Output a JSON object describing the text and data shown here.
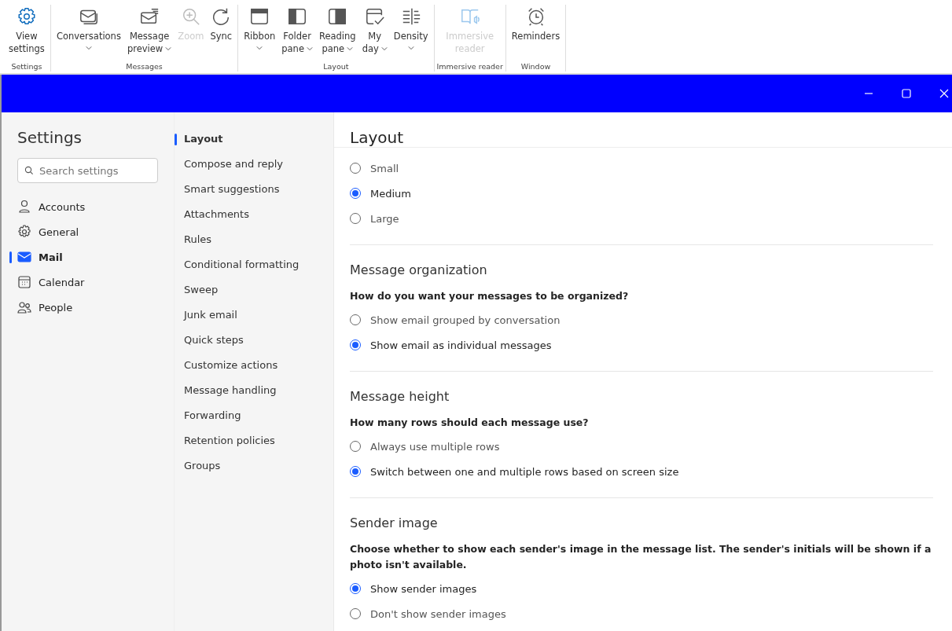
{
  "ribbon": {
    "groups": [
      {
        "label": "Settings",
        "items": [
          {
            "lines": [
              "View",
              "settings"
            ],
            "dropdown": false,
            "disabled": false
          }
        ]
      },
      {
        "label": "Messages",
        "items": [
          {
            "lines": [
              "Conversations"
            ],
            "dropdown": true,
            "disabled": false
          },
          {
            "lines": [
              "Message",
              "preview"
            ],
            "dropdown": true,
            "disabled": false
          },
          {
            "lines": [
              "Zoom"
            ],
            "dropdown": false,
            "disabled": true
          },
          {
            "lines": [
              "Sync"
            ],
            "dropdown": false,
            "disabled": false
          }
        ]
      },
      {
        "label": "Layout",
        "items": [
          {
            "lines": [
              "Ribbon"
            ],
            "dropdown": true,
            "disabled": false
          },
          {
            "lines": [
              "Folder",
              "pane"
            ],
            "dropdown": true,
            "disabled": false
          },
          {
            "lines": [
              "Reading",
              "pane"
            ],
            "dropdown": true,
            "disabled": false
          },
          {
            "lines": [
              "My",
              "day"
            ],
            "dropdown": true,
            "disabled": false
          },
          {
            "lines": [
              "Density"
            ],
            "dropdown": true,
            "disabled": false
          }
        ]
      },
      {
        "label": "Immersive reader",
        "items": [
          {
            "lines": [
              "Immersive",
              "reader"
            ],
            "dropdown": false,
            "disabled": true
          }
        ]
      },
      {
        "label": "Window",
        "items": [
          {
            "lines": [
              "Reminders"
            ],
            "dropdown": false,
            "disabled": false
          }
        ]
      }
    ]
  },
  "settings": {
    "title": "Settings",
    "search": {
      "placeholder": "Search settings"
    },
    "nav": [
      {
        "label": "Accounts",
        "selected": false
      },
      {
        "label": "General",
        "selected": false
      },
      {
        "label": "Mail",
        "selected": true
      },
      {
        "label": "Calendar",
        "selected": false
      },
      {
        "label": "People",
        "selected": false
      }
    ],
    "subnav": [
      {
        "label": "Layout",
        "selected": true
      },
      {
        "label": "Compose and reply",
        "selected": false
      },
      {
        "label": "Smart suggestions",
        "selected": false
      },
      {
        "label": "Attachments",
        "selected": false
      },
      {
        "label": "Rules",
        "selected": false
      },
      {
        "label": "Conditional formatting",
        "selected": false
      },
      {
        "label": "Sweep",
        "selected": false
      },
      {
        "label": "Junk email",
        "selected": false
      },
      {
        "label": "Quick steps",
        "selected": false
      },
      {
        "label": "Customize actions",
        "selected": false
      },
      {
        "label": "Message handling",
        "selected": false
      },
      {
        "label": "Forwarding",
        "selected": false
      },
      {
        "label": "Retention policies",
        "selected": false
      },
      {
        "label": "Groups",
        "selected": false
      }
    ]
  },
  "content": {
    "title": "Layout",
    "sections": [
      {
        "options": [
          {
            "label": "Small",
            "selected": false
          },
          {
            "label": "Medium",
            "selected": true
          },
          {
            "label": "Large",
            "selected": false
          }
        ]
      },
      {
        "title": "Message organization",
        "question": "How do you want your messages to be organized?",
        "options": [
          {
            "label": "Show email grouped by conversation",
            "selected": false
          },
          {
            "label": "Show email as individual messages",
            "selected": true
          }
        ]
      },
      {
        "title": "Message height",
        "question": "How many rows should each message use?",
        "options": [
          {
            "label": "Always use multiple rows",
            "selected": false
          },
          {
            "label": "Switch between one and multiple rows based on screen size",
            "selected": true
          }
        ]
      },
      {
        "title": "Sender image",
        "question": "Choose whether to show each sender's image in the message list. The sender's initials will be shown if a photo isn't available.",
        "options": [
          {
            "label": "Show sender images",
            "selected": true
          },
          {
            "label": "Don't show sender images",
            "selected": false
          }
        ]
      }
    ]
  }
}
